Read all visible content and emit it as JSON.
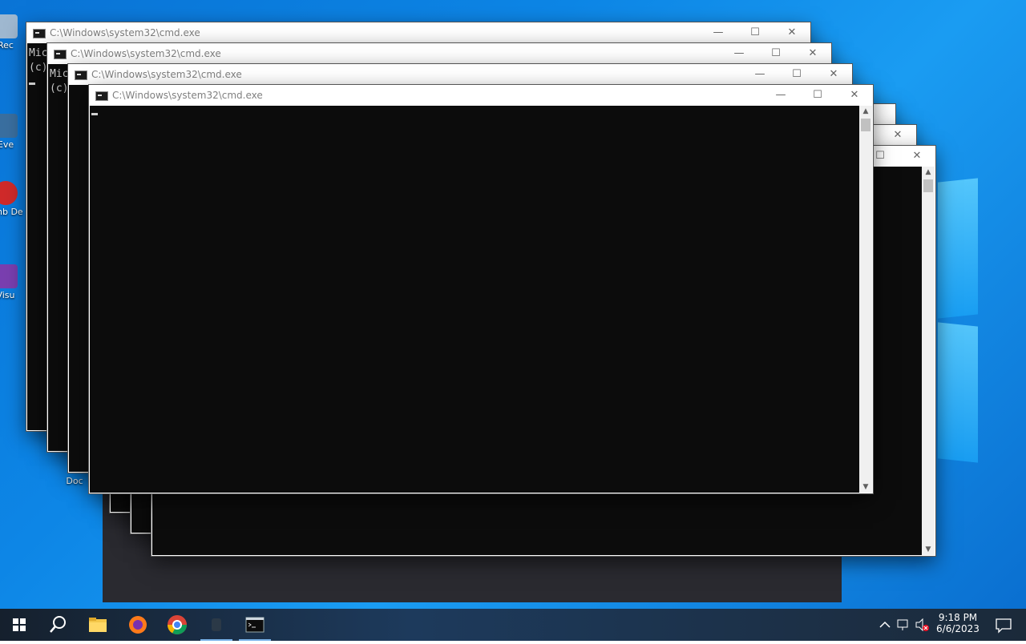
{
  "desktop": {
    "icons": [
      {
        "label": "Rec",
        "name": "recycle-bin"
      },
      {
        "label": "Eve",
        "name": "event-viewer"
      },
      {
        "label": "Emb De",
        "name": "embedded-app"
      },
      {
        "label": "Visu",
        "name": "visual-studio"
      },
      {
        "label": "Doc",
        "name": "documents"
      }
    ]
  },
  "windows": [
    {
      "title": "C:\\Windows\\system32\\cmd.exe",
      "lines": [
        "Mic",
        "(c)"
      ]
    },
    {
      "title": "C:\\Windows\\system32\\cmd.exe",
      "lines": [
        "Mic",
        "(c)"
      ]
    },
    {
      "title": "C:\\Windows\\system32\\cmd.exe",
      "lines": []
    },
    {
      "title": "C:\\Windows\\system32\\cmd.exe",
      "lines": []
    }
  ],
  "controls": {
    "minimize": "—",
    "maximize": "☐",
    "close": "✕"
  },
  "taskbar": {
    "start_label": "Start",
    "items": [
      "search",
      "file-explorer",
      "firefox",
      "chrome",
      "app",
      "command-prompt"
    ],
    "clock_time": "9:18 PM",
    "clock_date": "6/6/2023"
  },
  "colors": {
    "console_bg": "#0c0c0c",
    "desktop": "#0d86e6",
    "taskbar": "#1b2a3a"
  }
}
